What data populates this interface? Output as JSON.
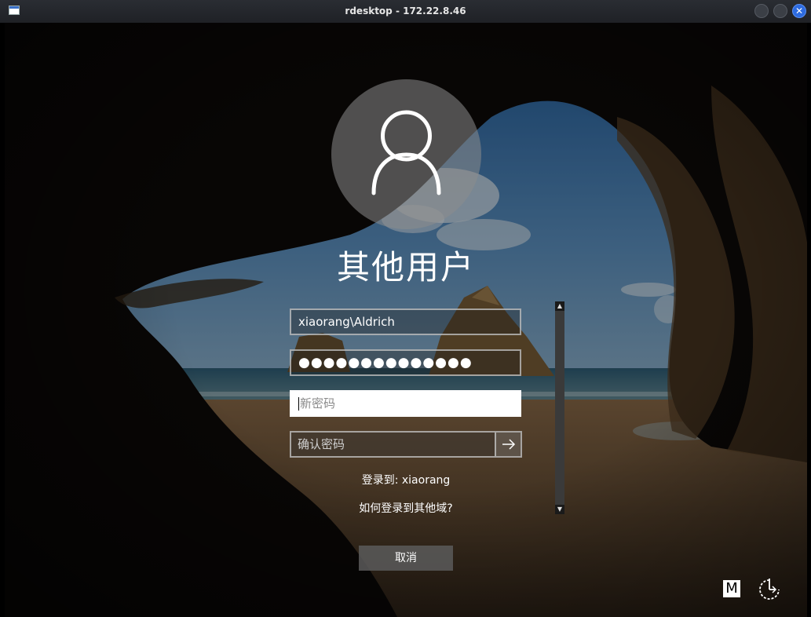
{
  "window": {
    "title": "rdesktop - 172.22.8.46",
    "close_glyph": "✕"
  },
  "logon": {
    "user_title": "其他用户",
    "username_value": "xiaorang\\Aldrich",
    "password_mask": "●●●●●●●●●●●●●●",
    "new_password_placeholder": "新密码",
    "confirm_password_placeholder": "确认密码",
    "sign_in_to": "登录到: xiaorang",
    "other_domain_link": "如何登录到其他域?",
    "cancel_label": "取消"
  },
  "scrollbar": {
    "up_glyph": "▲",
    "down_glyph": "▼"
  },
  "tray": {
    "ime_label": "M",
    "icons": [
      "input-method-icon",
      "power-options-icon"
    ]
  },
  "colors": {
    "titlebar": "#1f2126",
    "close_button": "#2d6be0",
    "field_active_bg": "#ffffff",
    "cancel_bg": "#5a5a5a"
  }
}
